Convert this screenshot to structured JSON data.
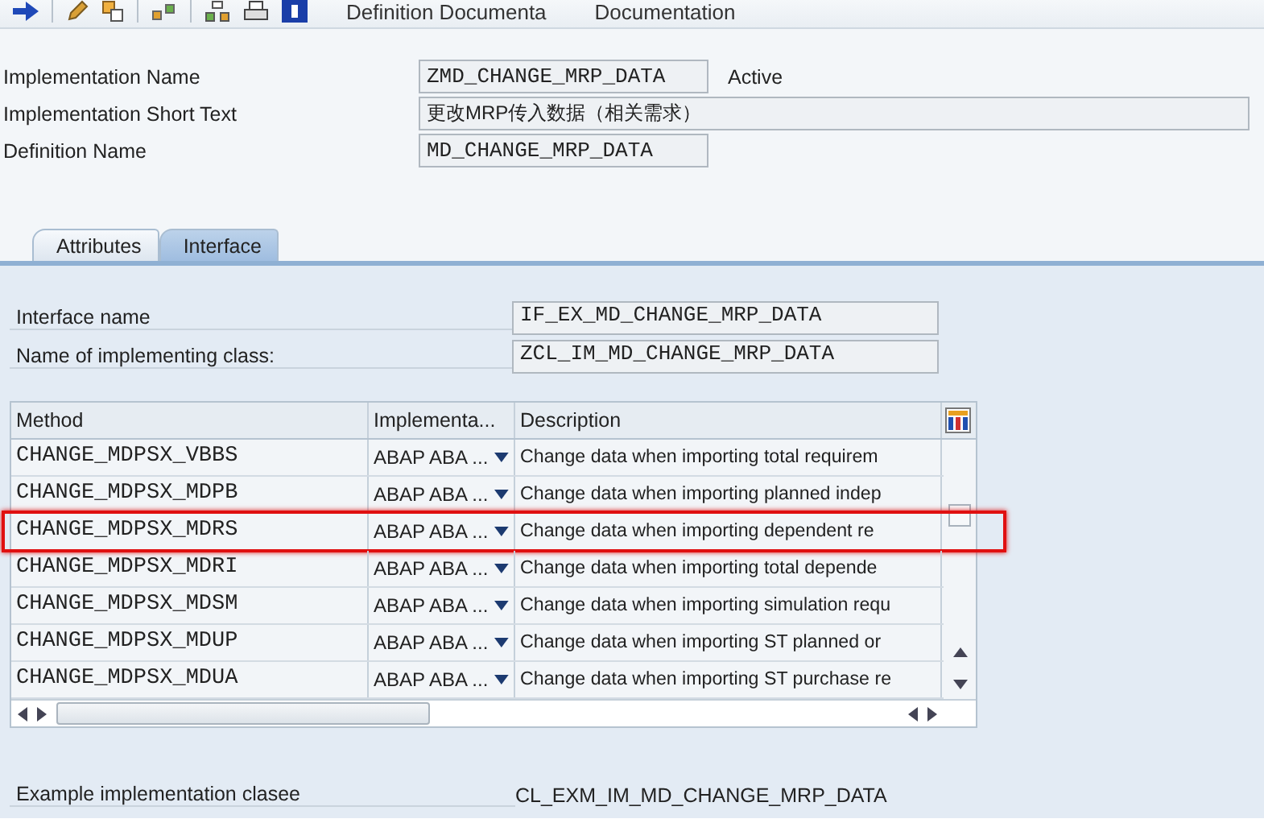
{
  "toolbar": {
    "buttons": [
      {
        "label": "Definition Documenta"
      },
      {
        "label": "Documentation"
      }
    ]
  },
  "header_fields": [
    {
      "label": "Implementation Name",
      "value": "ZMD_CHANGE_MRP_DATA",
      "kind": "code",
      "status": "Active"
    },
    {
      "label": "Implementation Short Text",
      "value": "更改MRP传入数据（相关需求）",
      "kind": "text"
    },
    {
      "label": "Definition Name",
      "value": "MD_CHANGE_MRP_DATA",
      "kind": "code"
    }
  ],
  "tabs": [
    {
      "label": "Attributes",
      "selected": false
    },
    {
      "label": "Interface",
      "selected": true
    }
  ],
  "interface_fields": [
    {
      "label": "Interface name",
      "value": "IF_EX_MD_CHANGE_MRP_DATA"
    },
    {
      "label": "Name of implementing class:",
      "value": "ZCL_IM_MD_CHANGE_MRP_DATA"
    }
  ],
  "table": {
    "columns": [
      "Method",
      "Implementa...",
      "Description"
    ],
    "rows": [
      {
        "method": "CHANGE_MDPSX_VBBS",
        "implementation": "ABAP ABA ...",
        "description": "Change data when importing total requirem",
        "highlighted": false
      },
      {
        "method": "CHANGE_MDPSX_MDPB",
        "implementation": "ABAP ABA ...",
        "description": "Change data when importing planned indep",
        "highlighted": false
      },
      {
        "method": "CHANGE_MDPSX_MDRS",
        "implementation": "ABAP ABA ...",
        "description": "Change data when importing dependent re",
        "highlighted": true
      },
      {
        "method": "CHANGE_MDPSX_MDRI",
        "implementation": "ABAP ABA ...",
        "description": "Change data when importing total depende",
        "highlighted": false
      },
      {
        "method": "CHANGE_MDPSX_MDSM",
        "implementation": "ABAP ABA ...",
        "description": "Change data when importing simulation requ",
        "highlighted": false
      },
      {
        "method": "CHANGE_MDPSX_MDUP",
        "implementation": "ABAP ABA ...",
        "description": "Change data when importing ST planned or",
        "highlighted": false
      },
      {
        "method": "CHANGE_MDPSX_MDUA",
        "implementation": "ABAP ABA ...",
        "description": "Change data when importing ST purchase re",
        "highlighted": false
      }
    ]
  },
  "example": {
    "label": "Example implementation clasee",
    "value": "CL_EXM_IM_MD_CHANGE_MRP_DATA"
  }
}
